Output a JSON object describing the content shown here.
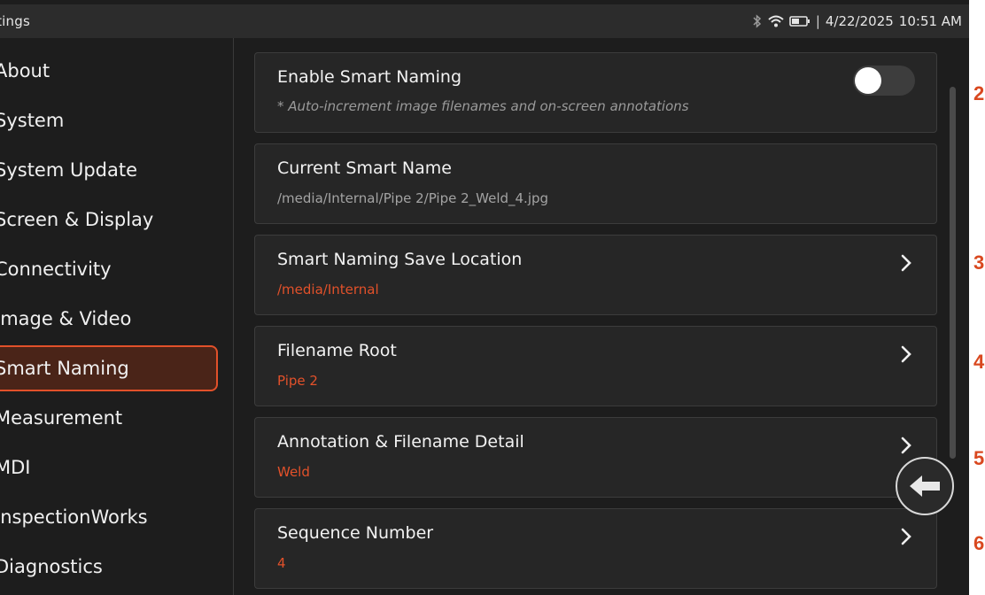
{
  "status_bar": {
    "title": "ttings",
    "date": "4/22/2025",
    "time": "10:51 AM",
    "separator": "|",
    "icons": [
      "bluetooth-icon",
      "wifi-icon",
      "battery-icon"
    ]
  },
  "sidebar": {
    "items": [
      {
        "label": "About"
      },
      {
        "label": "System"
      },
      {
        "label": "System Update"
      },
      {
        "label": "Screen & Display"
      },
      {
        "label": "Connectivity"
      },
      {
        "label": "Image & Video"
      },
      {
        "label": "Smart Naming",
        "active": true
      },
      {
        "label": "Measurement"
      },
      {
        "label": "MDI"
      },
      {
        "label": "InspectionWorks"
      },
      {
        "label": "Diagnostics"
      }
    ]
  },
  "settings": {
    "enable_smart_naming": {
      "title": "Enable Smart Naming",
      "description": "* Auto-increment image filenames and on-screen annotations",
      "enabled": false
    },
    "current_smart_name": {
      "title": "Current Smart Name",
      "value": "/media/Internal/Pipe 2/Pipe 2_Weld_4.jpg"
    },
    "save_location": {
      "title": "Smart Naming Save Location",
      "value": "/media/Internal"
    },
    "filename_root": {
      "title": "Filename Root",
      "value": "Pipe 2"
    },
    "annotation_detail": {
      "title": "Annotation & Filename Detail",
      "value": "Weld"
    },
    "sequence_number": {
      "title": "Sequence Number",
      "value": "4"
    }
  },
  "callouts": [
    "2",
    "3",
    "4",
    "5",
    "6"
  ],
  "colors": {
    "accent": "#e2512a",
    "background": "#1d1d1d",
    "card": "#262626",
    "callout": "#d9481f"
  }
}
